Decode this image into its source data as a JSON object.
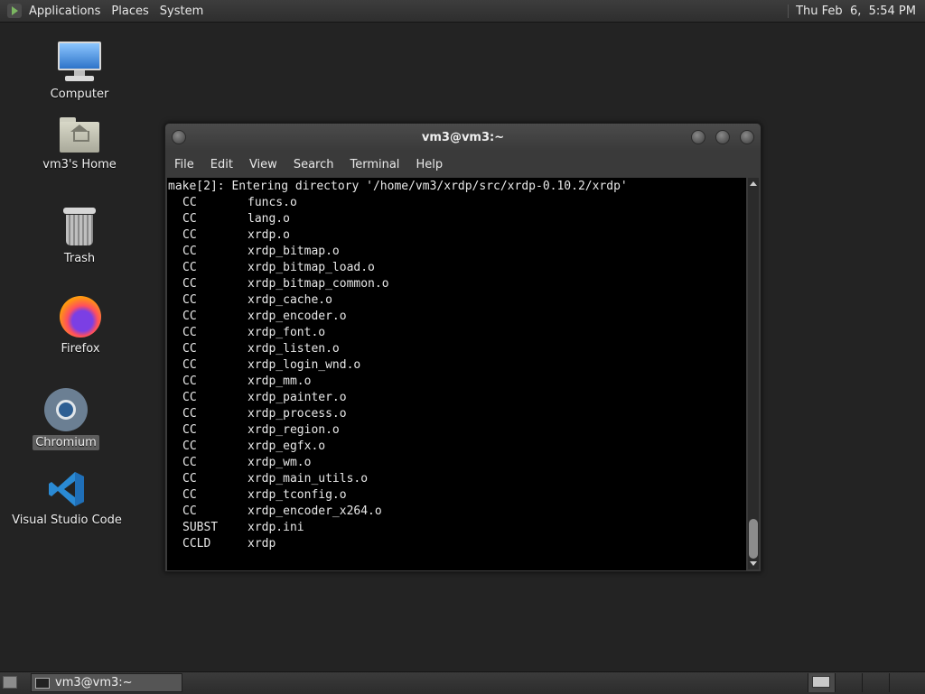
{
  "top_panel": {
    "menus": [
      "Applications",
      "Places",
      "System"
    ],
    "clock": "Thu Feb  6,  5:54 PM"
  },
  "desktop_icons": [
    {
      "label": "Computer",
      "icon": "computer-icon"
    },
    {
      "label": "vm3's Home",
      "icon": "home-folder-icon"
    },
    {
      "label": "Trash",
      "icon": "trash-icon"
    },
    {
      "label": "Firefox",
      "icon": "firefox-icon"
    },
    {
      "label": "Chromium",
      "icon": "chromium-icon",
      "selected": true
    },
    {
      "label": "Visual Studio Code",
      "icon": "vscode-icon"
    }
  ],
  "terminal": {
    "title": "vm3@vm3:~",
    "menu": [
      "File",
      "Edit",
      "View",
      "Search",
      "Terminal",
      "Help"
    ],
    "first_line": "make[2]: Entering directory '/home/vm3/xrdp/src/xrdp-0.10.2/xrdp'",
    "lines": [
      {
        "cmd": "CC",
        "file": "funcs.o"
      },
      {
        "cmd": "CC",
        "file": "lang.o"
      },
      {
        "cmd": "CC",
        "file": "xrdp.o"
      },
      {
        "cmd": "CC",
        "file": "xrdp_bitmap.o"
      },
      {
        "cmd": "CC",
        "file": "xrdp_bitmap_load.o"
      },
      {
        "cmd": "CC",
        "file": "xrdp_bitmap_common.o"
      },
      {
        "cmd": "CC",
        "file": "xrdp_cache.o"
      },
      {
        "cmd": "CC",
        "file": "xrdp_encoder.o"
      },
      {
        "cmd": "CC",
        "file": "xrdp_font.o"
      },
      {
        "cmd": "CC",
        "file": "xrdp_listen.o"
      },
      {
        "cmd": "CC",
        "file": "xrdp_login_wnd.o"
      },
      {
        "cmd": "CC",
        "file": "xrdp_mm.o"
      },
      {
        "cmd": "CC",
        "file": "xrdp_painter.o"
      },
      {
        "cmd": "CC",
        "file": "xrdp_process.o"
      },
      {
        "cmd": "CC",
        "file": "xrdp_region.o"
      },
      {
        "cmd": "CC",
        "file": "xrdp_egfx.o"
      },
      {
        "cmd": "CC",
        "file": "xrdp_wm.o"
      },
      {
        "cmd": "CC",
        "file": "xrdp_main_utils.o"
      },
      {
        "cmd": "CC",
        "file": "xrdp_tconfig.o"
      },
      {
        "cmd": "CC",
        "file": "xrdp_encoder_x264.o"
      },
      {
        "cmd": "SUBST",
        "file": "xrdp.ini"
      },
      {
        "cmd": "CCLD",
        "file": "xrdp"
      }
    ]
  },
  "bottom_panel": {
    "task_label": "vm3@vm3:~"
  }
}
